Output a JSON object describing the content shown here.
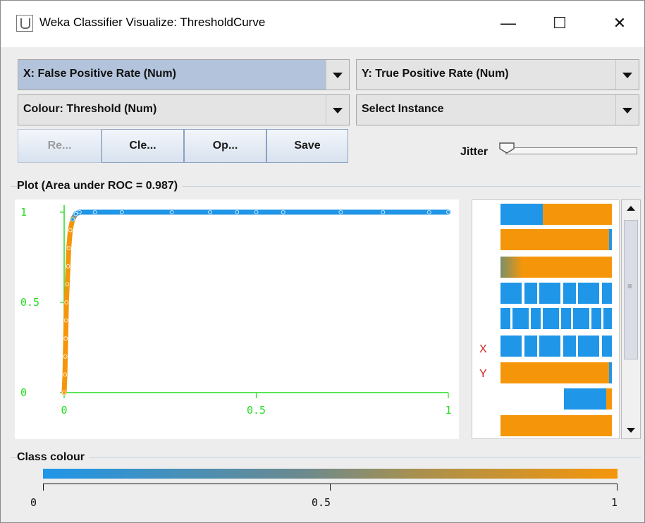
{
  "window": {
    "title": "Weka Classifier Visualize: ThresholdCurve",
    "controls": [
      "—",
      "☐",
      "✕"
    ]
  },
  "selectors": {
    "x": "X: False Positive Rate (Num)",
    "y": "Y: True Positive Rate (Num)",
    "colour": "Colour: Threshold (Num)",
    "instance": "Select Instance"
  },
  "buttons": {
    "reset": "Re...",
    "clear": "Cle...",
    "open": "Op...",
    "save": "Save"
  },
  "jitter": {
    "label": "Jitter",
    "value": 0
  },
  "plot": {
    "group_label": "Plot (Area under ROC = 0.987)",
    "x_ticks": [
      "0",
      "0.5",
      "1"
    ],
    "y_ticks": [
      "0",
      "0.5",
      "1"
    ]
  },
  "attribute_panel": {
    "x_marker": "X",
    "y_marker": "Y"
  },
  "class_colour": {
    "group_label": "Class colour",
    "ticks": [
      "0",
      "0.5",
      "1"
    ],
    "low_color": "#1f96e8",
    "high_color": "#f5960a"
  },
  "colors": {
    "axis": "#22dd22",
    "low": "#1f96e8",
    "high": "#f5960a",
    "marker_letter": "#cc2222"
  },
  "chart_data": {
    "type": "scatter",
    "title": "",
    "xlabel": "False Positive Rate",
    "ylabel": "True Positive Rate",
    "xlim": [
      0,
      1
    ],
    "ylim": [
      0,
      1
    ],
    "series": [
      {
        "name": "Threshold",
        "points": [
          [
            0.0,
            0.0
          ],
          [
            0.002,
            0.1
          ],
          [
            0.003,
            0.2
          ],
          [
            0.004,
            0.3
          ],
          [
            0.005,
            0.4
          ],
          [
            0.006,
            0.5
          ],
          [
            0.008,
            0.6
          ],
          [
            0.01,
            0.7
          ],
          [
            0.012,
            0.8
          ],
          [
            0.016,
            0.9
          ],
          [
            0.022,
            0.96
          ],
          [
            0.03,
            0.99
          ],
          [
            0.04,
            1.0
          ],
          [
            0.08,
            1.0
          ],
          [
            0.15,
            1.0
          ],
          [
            0.28,
            1.0
          ],
          [
            0.38,
            1.0
          ],
          [
            0.45,
            1.0
          ],
          [
            0.5,
            1.0
          ],
          [
            0.57,
            1.0
          ],
          [
            0.72,
            1.0
          ],
          [
            0.83,
            1.0
          ],
          [
            0.95,
            1.0
          ],
          [
            1.0,
            1.0
          ]
        ]
      }
    ]
  }
}
